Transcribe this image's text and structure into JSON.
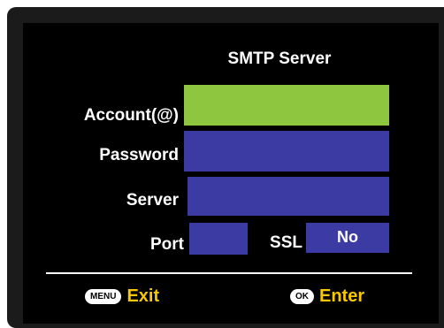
{
  "screen": {
    "title": "SMTP Server",
    "fields": {
      "account": {
        "label": "Account(@)",
        "value": ""
      },
      "password": {
        "label": "Password",
        "value": ""
      },
      "server": {
        "label": "Server",
        "value": ""
      },
      "port": {
        "label": "Port",
        "value": ""
      },
      "ssl": {
        "label": "SSL",
        "value": "No"
      }
    },
    "footer": {
      "exit_key": "MENU",
      "exit_label": "Exit",
      "enter_key": "OK",
      "enter_label": "Enter"
    }
  },
  "colors": {
    "field_bg": "#3c3aa3",
    "selected_bg": "#8ec63f",
    "footer_text": "#f7c800"
  }
}
